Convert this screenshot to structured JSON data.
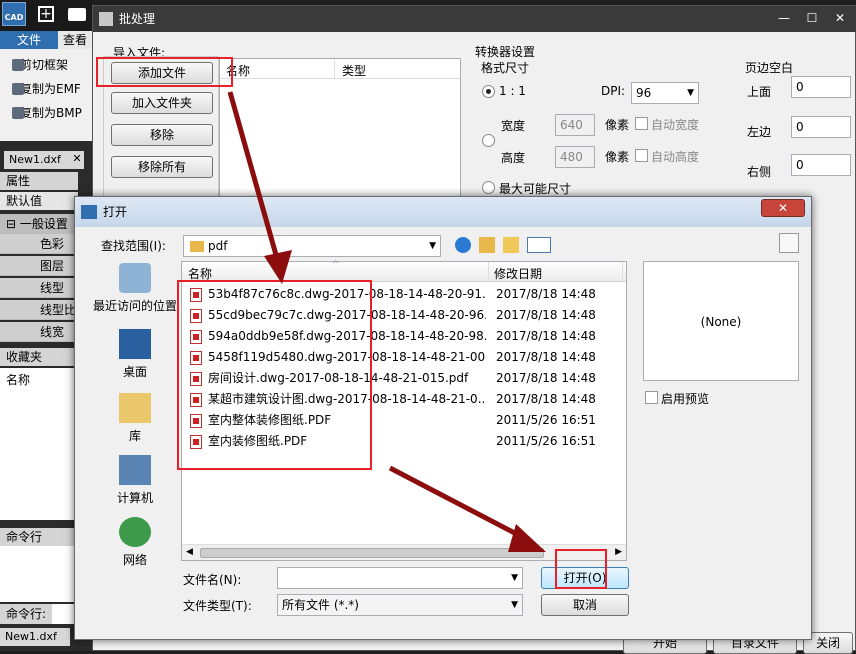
{
  "cad": {
    "logo": "CAD",
    "tabs": [
      "文件",
      "查看"
    ],
    "ribbon_items": [
      "剪切框架",
      "复制为EMF",
      "复制为BMP"
    ],
    "doc_tab": "New1.dxf",
    "properties_header": "属性",
    "default_value": "默认值",
    "general_settings": "一般设置",
    "prop_rows": [
      "色彩",
      "图层",
      "线型",
      "线型比",
      "线宽"
    ],
    "favorites": "收藏夹",
    "name_label": "名称",
    "command_line": "命令行",
    "command_prompt": "命令行:",
    "bottom_tab": "New1.dxf"
  },
  "batch": {
    "title": "批处理",
    "import_group": "导入文件:",
    "buttons": {
      "add_file": "添加文件",
      "add_folder": "加入文件夹",
      "remove": "移除",
      "remove_all": "移除所有"
    },
    "list_cols": [
      "名称",
      "类型"
    ],
    "converter": "转换器设置",
    "format_size": "格式尺寸",
    "ratio": "1 : 1",
    "dpi_label": "DPI:",
    "dpi_value": "96",
    "width_label": "宽度",
    "width_value": "640",
    "height_label": "高度",
    "height_value": "480",
    "pixel": "像素",
    "auto_width": "自动宽度",
    "auto_height": "自动高度",
    "max_size": "最大可能尺寸",
    "margins": "页边空白",
    "top_label": "上面",
    "top_value": "0",
    "left_label": "左边",
    "left_value": "0",
    "right_label": "右侧",
    "right_value": "0",
    "bottom_buttons": [
      "开始",
      "目录文件",
      "关闭"
    ]
  },
  "open_dialog": {
    "title": "打开",
    "look_in_label": "查找范围(I):",
    "look_in_value": "pdf",
    "places": [
      "最近访问的位置",
      "桌面",
      "库",
      "计算机",
      "网络"
    ],
    "columns": [
      "名称",
      "修改日期"
    ],
    "files": [
      {
        "name": "53b4f87c76c8c.dwg-2017-08-18-14-48-20-91...",
        "date": "2017/8/18 14:48"
      },
      {
        "name": "55cd9bec79c7c.dwg-2017-08-18-14-48-20-96...",
        "date": "2017/8/18 14:48"
      },
      {
        "name": "594a0ddb9e58f.dwg-2017-08-18-14-48-20-98...",
        "date": "2017/8/18 14:48"
      },
      {
        "name": "5458f119d5480.dwg-2017-08-18-14-48-21-00...",
        "date": "2017/8/18 14:48"
      },
      {
        "name": "房间设计.dwg-2017-08-18-14-48-21-015.pdf",
        "date": "2017/8/18 14:48"
      },
      {
        "name": "某超市建筑设计图.dwg-2017-08-18-14-48-21-0...",
        "date": "2017/8/18 14:48"
      },
      {
        "name": "室内整体装修图纸.PDF",
        "date": "2011/5/26 16:51"
      },
      {
        "name": "室内装修图纸.PDF",
        "date": "2011/5/26 16:51"
      }
    ],
    "preview_none": "(None)",
    "enable_preview": "启用预览",
    "filename_label": "文件名(N):",
    "filetype_label": "文件类型(T):",
    "filetype_value": "所有文件 (*.*)",
    "open_button": "打开(O)",
    "cancel_button": "取消"
  },
  "colors": {
    "annotation": "#e8202a",
    "arrow": "#8b0d0d"
  }
}
